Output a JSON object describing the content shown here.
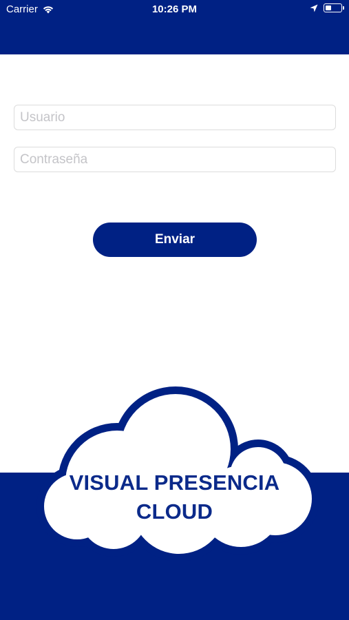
{
  "status_bar": {
    "carrier": "Carrier",
    "time": "10:26 PM",
    "icons": [
      "wifi-icon",
      "location-arrow-icon",
      "battery-icon"
    ]
  },
  "login_form": {
    "username_placeholder": "Usuario",
    "username_value": "",
    "password_placeholder": "Contraseña",
    "password_value": "",
    "submit_label": "Enviar"
  },
  "logo": {
    "line1": "VISUAL PRESENCIA",
    "line2": "CLOUD"
  },
  "colors": {
    "brand_blue": "#002184",
    "logo_text": "#0b2a8a",
    "background": "#ffffff",
    "field_border": "#dcdcdc",
    "placeholder": "#c4c4c8"
  }
}
